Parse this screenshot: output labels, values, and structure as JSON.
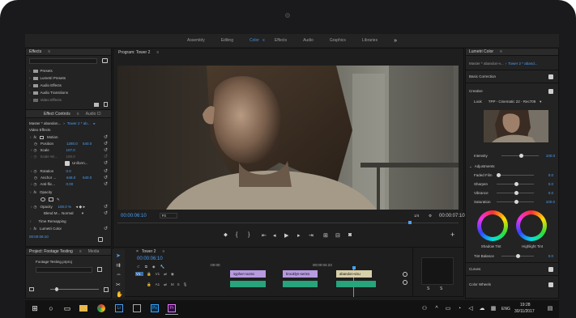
{
  "workspaces": [
    "Assembly",
    "Editing",
    "Color",
    "Effects",
    "Audio",
    "Graphics",
    "Libraries"
  ],
  "workspace_active": "Color",
  "workspace_more": "»",
  "effects_panel": {
    "title": "Effects",
    "items": [
      "Presets",
      "Lumetri Presets",
      "Audio Effects",
      "Audio Transitions",
      "Video Effects"
    ]
  },
  "effect_controls": {
    "tabs": [
      "Effect Controls",
      "Audio Cl"
    ],
    "master": "Master * abandon...",
    "clip": "Tower 2 * ab...",
    "section_video": "Video Effects",
    "motion": "Motion",
    "rows": [
      {
        "label": "Position",
        "v1": "1280.0",
        "v2": "540.0"
      },
      {
        "label": "Scale",
        "v1": "107.0",
        "v2": ""
      },
      {
        "label": "Scale Wi...",
        "v1": "100.0",
        "v2": ""
      },
      {
        "label": "Uniform...",
        "v1": "",
        "v2": ""
      },
      {
        "label": "Rotation",
        "v1": "0.0",
        "v2": ""
      },
      {
        "label": "Anchor ...",
        "v1": "648.0",
        "v2": "540.0"
      },
      {
        "label": "Anti-flic...",
        "v1": "0.00",
        "v2": ""
      }
    ],
    "opacity": "Opacity",
    "opacity_value": "100.0 %",
    "blend_label": "Blend M...",
    "blend_value": "Normal",
    "time_remap": "Time Remapping",
    "lumetri": "Lumetri Color",
    "timecode": "00:00:06:10"
  },
  "project_panel": {
    "tabs": [
      "Project: Footage Testing",
      "Media"
    ],
    "file": "Footage Testing.prproj"
  },
  "program_monitor": {
    "title": "Program: Tower 2",
    "timecode": "00:00:06:10",
    "fit": "Fit",
    "resolution": "1/4",
    "duration": "00:00:07:10"
  },
  "timeline": {
    "tab": "Tower 2",
    "timecode": "00:00:06:10",
    "ruler": [
      ":00:00",
      "00:00:04:23"
    ],
    "tracks": [
      "V1",
      "A1"
    ],
    "clips": [
      "sypher-roomc",
      "brooklyn-series",
      "abandon-visu"
    ]
  },
  "lumetri": {
    "title": "Lumetri Color",
    "master": "Master * abandon-v...",
    "clip": "Tower 2 * aband...",
    "sections": {
      "basic": "Basic Correction",
      "creative": "Creative",
      "curves": "Curves",
      "wheels": "Color Wheels"
    },
    "look_label": "Look",
    "look_value": "TPP - Cinematic 22 - Rec709",
    "intensity_label": "Intensity",
    "intensity_value": "100.0",
    "adjustments": "Adjustments",
    "sliders": [
      {
        "label": "Faded Film",
        "value": "0.0"
      },
      {
        "label": "Sharpen",
        "value": "0.0"
      },
      {
        "label": "Vibrance",
        "value": "0.0"
      },
      {
        "label": "Saturation",
        "value": "100.0"
      }
    ],
    "shadow_tint": "Shadow Tint",
    "highlight_tint": "Highlight Tint",
    "tint_balance_label": "Tint Balance",
    "tint_balance_value": "0.0"
  },
  "taskbar": {
    "lang": "ENG",
    "time": "19:28",
    "date": "30/11/2017"
  },
  "colors": {
    "accent": "#3d8fe0",
    "panel": "#232323",
    "clip_video": "#b79ae0",
    "clip_audio": "#27a47b"
  }
}
